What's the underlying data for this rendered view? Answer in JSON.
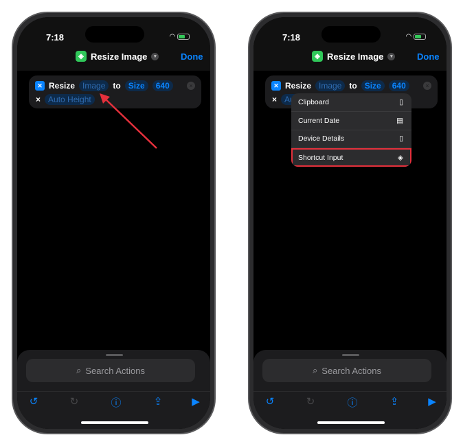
{
  "status": {
    "time": "7:18"
  },
  "header": {
    "title": "Resize Image",
    "done_label": "Done"
  },
  "action": {
    "verb": "Resize",
    "input_token": "Image",
    "connector": "to",
    "mode_token": "Size",
    "width_value": "640",
    "times": "×",
    "height_token": "Auto Height"
  },
  "menu": {
    "items": [
      {
        "label": "Clipboard",
        "icon": "clipboard-icon"
      },
      {
        "label": "Current Date",
        "icon": "calendar-icon"
      },
      {
        "label": "Device Details",
        "icon": "phone-icon"
      },
      {
        "label": "Shortcut Input",
        "icon": "layers-icon"
      }
    ],
    "highlighted": "Shortcut Input",
    "highlight_color": "#e5303c"
  },
  "sheet": {
    "search_placeholder": "Search Actions"
  },
  "colors": {
    "accent": "#0a84ff",
    "annotation": "#e5303c"
  }
}
